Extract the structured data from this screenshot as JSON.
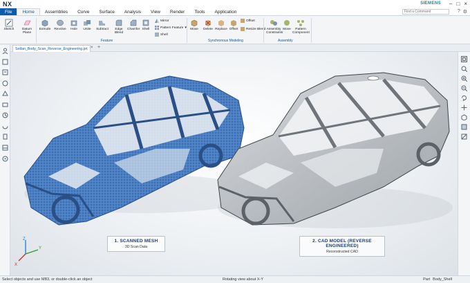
{
  "app": {
    "logo": "NX",
    "brand": "SIEMENS"
  },
  "window_controls": [
    "–",
    "□",
    "×"
  ],
  "menu": {
    "file": "File",
    "tabs": [
      "Home",
      "Assemblies",
      "Curve",
      "Surface",
      "Analysis",
      "View",
      "Render",
      "Tools",
      "Application"
    ],
    "active_tab": "Home",
    "search_placeholder": "Find a Command"
  },
  "ribbon": {
    "sketch": "Sketch",
    "datum": "Datum Plane",
    "extrude": "Extrude",
    "revolve": "Revolve",
    "hole": "Hole",
    "unite": "Unite",
    "subtract": "Subtract",
    "edge_blend": "Edge Blend",
    "chamfer": "Chamfer",
    "shell": "Shell",
    "mirror": "Mirror",
    "pattern_feature": "Pattern Feature",
    "shell_small": "Shell",
    "move": "Move",
    "delete": "Delete",
    "replace": "Replace",
    "offset": "Offset",
    "offset_small": "Offset",
    "resize_blend": "Resize Blend",
    "assembly_constraints": "Assembly Constraints",
    "move_component": "Move",
    "pattern_component": "Pattern Component",
    "groups": {
      "feature": "Feature",
      "synchronous": "Synchronous Modeling",
      "assembly": "Assembly"
    }
  },
  "document_tab": {
    "name": "Sedan_Body_Scan_Reverse_Engineering.prt"
  },
  "captions": {
    "left_title": "1. SCANNED MESH",
    "left_sub": "3D Scan Data",
    "right_title": "2. CAD MODEL (REVERSE ENGINEERED)",
    "right_sub": "Reconstructed CAD"
  },
  "triad": {
    "x": "X",
    "y": "Y",
    "z": "Z"
  },
  "status": {
    "left": "Select objects and use MB3, or double-click an object",
    "mid": "Rotating view about X-Y",
    "part_label": "Part",
    "part_value": "Body_Shell"
  },
  "colors": {
    "accent": "#0b5cad",
    "mesh": "#4a7fc4",
    "cad": "#b9bec4"
  },
  "icons": [
    "sketch-icon",
    "datum-plane-icon",
    "extrude-icon",
    "revolve-icon",
    "hole-icon",
    "unite-icon",
    "subtract-icon",
    "edge-blend-icon",
    "chamfer-icon",
    "shell-icon",
    "mirror-icon",
    "pattern-icon",
    "move-icon",
    "delete-icon",
    "replace-icon",
    "offset-icon",
    "resize-icon",
    "constraint-icon",
    "pattern-component-icon"
  ]
}
